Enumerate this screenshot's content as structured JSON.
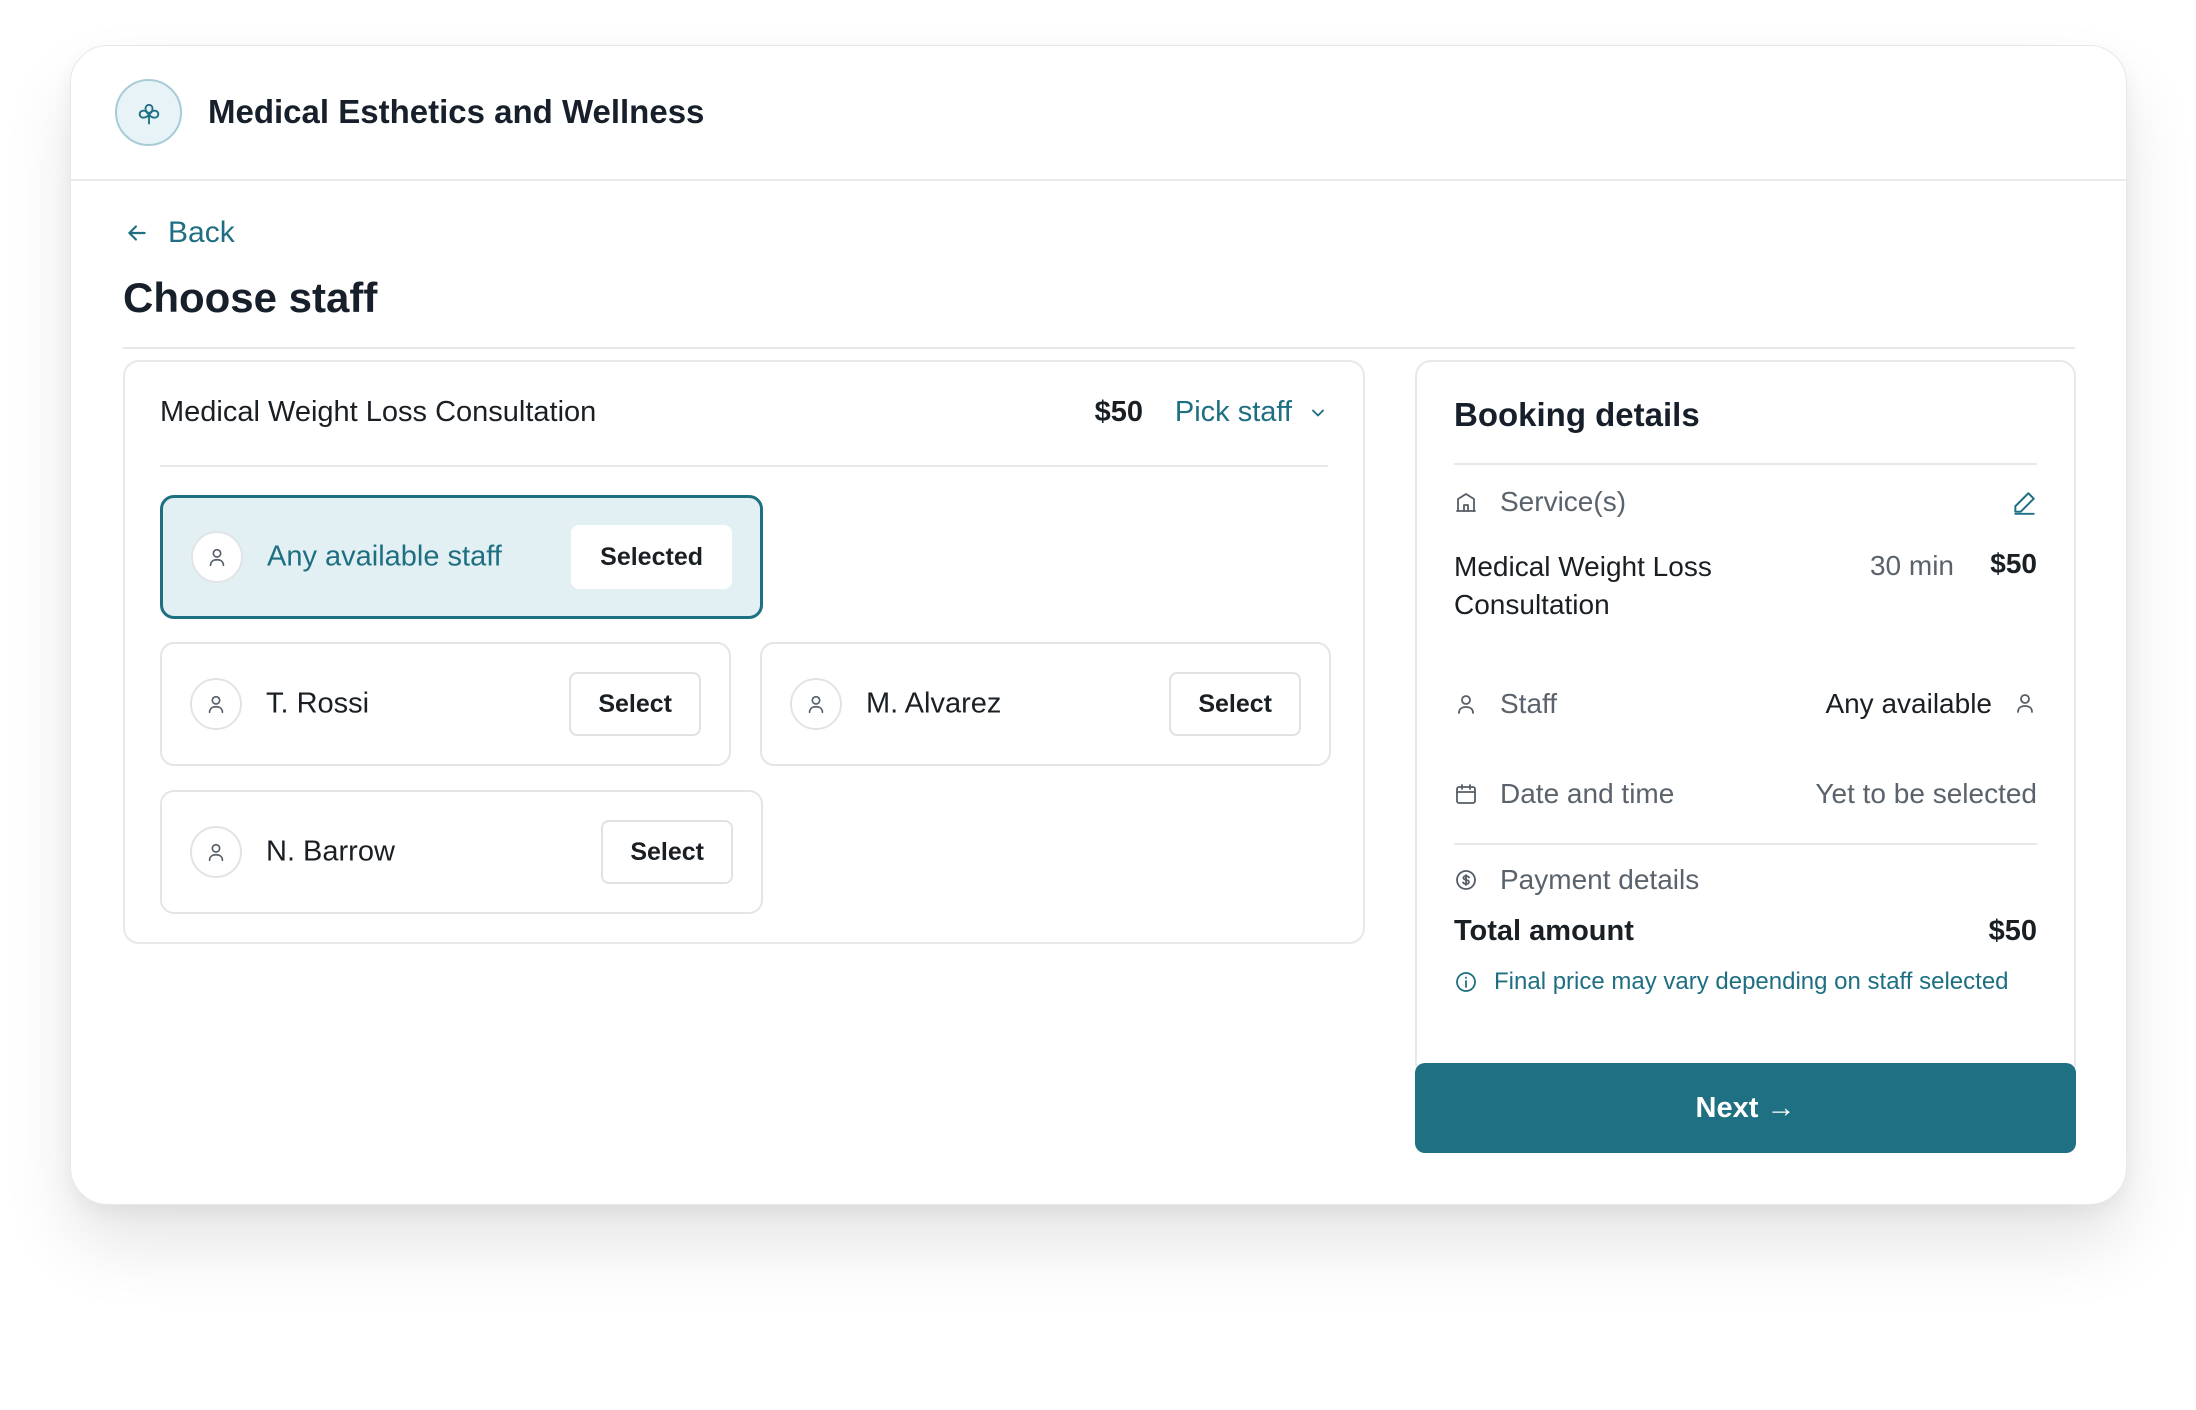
{
  "app": {
    "title": "Medical Esthetics and Wellness",
    "logo_icon": "flower-icon"
  },
  "nav": {
    "back_label": "Back"
  },
  "page": {
    "title": "Choose staff"
  },
  "service": {
    "name": "Medical Weight Loss Consultation",
    "price": "$50",
    "pick_staff_label": "Pick staff"
  },
  "staff_options": [
    {
      "name": "Any available staff",
      "button": "Selected",
      "selected": true
    },
    {
      "name": "T. Rossi",
      "button": "Select",
      "selected": false
    },
    {
      "name": "M. Alvarez",
      "button": "Select",
      "selected": false
    },
    {
      "name": "N. Barrow",
      "button": "Select",
      "selected": false
    }
  ],
  "booking": {
    "title": "Booking details",
    "services_label": "Service(s)",
    "service_name": "Medical Weight Loss Consultation",
    "service_duration": "30 min",
    "service_price": "$50",
    "staff_label": "Staff",
    "staff_value": "Any available",
    "datetime_label": "Date and time",
    "datetime_value": "Yet to be selected",
    "payment_label": "Payment details",
    "total_label": "Total amount",
    "total_value": "$50",
    "note": "Final price may vary depending on staff selected"
  },
  "next_label": "Next →",
  "colors": {
    "accent": "#1e7082",
    "selected_bg": "#e3f0f3",
    "border": "#e6e9ec"
  }
}
